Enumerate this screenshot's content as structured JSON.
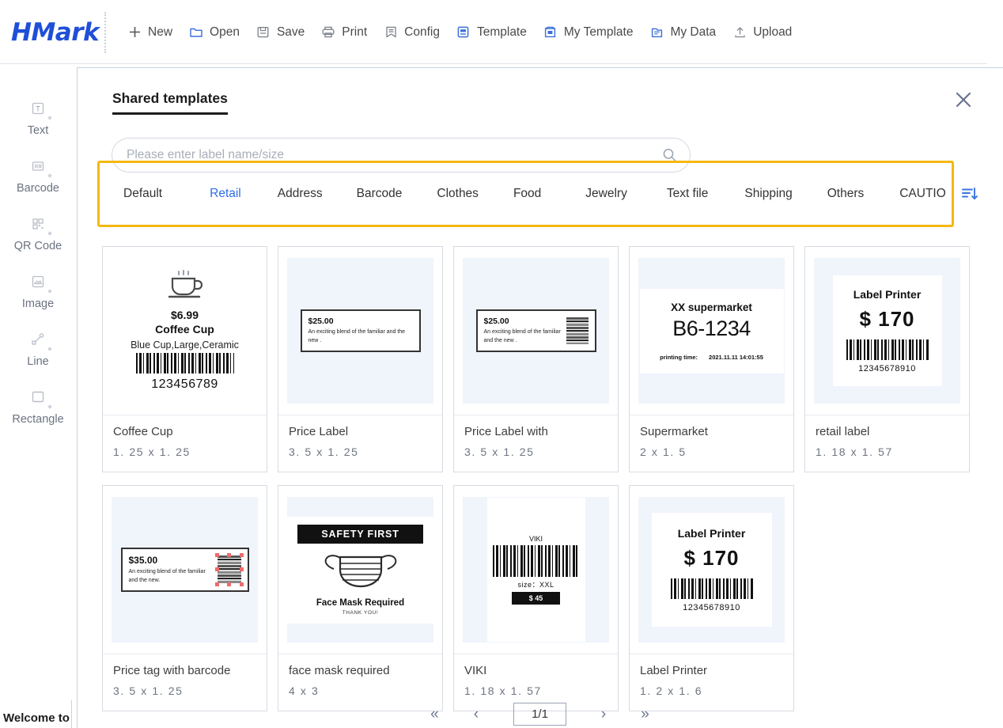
{
  "app": {
    "brand": "HMark",
    "menu": [
      {
        "label": "New",
        "icon": "plus-icon"
      },
      {
        "label": "Open",
        "icon": "folder-icon"
      },
      {
        "label": "Save",
        "icon": "save-disk-icon"
      },
      {
        "label": "Print",
        "icon": "printer-icon"
      },
      {
        "label": "Config",
        "icon": "bookmark-config-icon"
      },
      {
        "label": "Template",
        "icon": "template-icon"
      },
      {
        "label": "My Template",
        "icon": "my-template-icon"
      },
      {
        "label": "My Data",
        "icon": "my-data-icon"
      },
      {
        "label": "Upload",
        "icon": "upload-icon"
      }
    ]
  },
  "toolbar_rail": {
    "tools": [
      {
        "label": "Text",
        "icon": "text-tool-icon"
      },
      {
        "label": "Barcode",
        "icon": "barcode-tool-icon"
      },
      {
        "label": "QR Code",
        "icon": "qrcode-tool-icon"
      },
      {
        "label": "Image",
        "icon": "image-tool-icon"
      },
      {
        "label": "Line",
        "icon": "line-tool-icon"
      },
      {
        "label": "Rectangle",
        "icon": "rectangle-tool-icon"
      }
    ]
  },
  "dialog": {
    "title": "Shared templates",
    "close_icon": "close-icon",
    "search": {
      "placeholder": "Please enter label name/size",
      "value": "",
      "icon": "search-icon"
    },
    "sort_icon": "sort-descending-icon",
    "highlight_color": "#f5b812",
    "active_tab_color": "#2f6fe4",
    "tabs": [
      {
        "label": "Default",
        "active": false
      },
      {
        "label": "Retail",
        "active": true
      },
      {
        "label": "Address",
        "active": false
      },
      {
        "label": "Barcode",
        "active": false
      },
      {
        "label": "Clothes",
        "active": false
      },
      {
        "label": "Food",
        "active": false
      },
      {
        "label": "Jewelry",
        "active": false
      },
      {
        "label": "Text file",
        "active": false
      },
      {
        "label": "Shipping",
        "active": false
      },
      {
        "label": "Others",
        "active": false
      },
      {
        "label": "CAUTIO",
        "active": false
      }
    ],
    "templates": [
      {
        "name": "Coffee Cup",
        "size": "1. 25  x  1. 25",
        "preview": {
          "kind": "coffee",
          "price": "$6.99",
          "title": "Coffee Cup",
          "desc": "Blue Cup,Large,Ceramic",
          "barcode_number": "123456789"
        }
      },
      {
        "name": "Price Label",
        "size": "3. 5  x  1. 25",
        "preview": {
          "kind": "pricelabel",
          "price": "$25.00",
          "desc": "An exciting blend of  the familiar and the new .",
          "barcode": false
        }
      },
      {
        "name": "Price Label with",
        "size": "3. 5  x  1. 25",
        "preview": {
          "kind": "pricelabel",
          "price": "$25.00",
          "desc": "An exciting blend of  the familiar and the new .",
          "barcode": true
        }
      },
      {
        "name": "Supermarket",
        "size": "2  x  1. 5",
        "preview": {
          "kind": "supermarket",
          "header": "XX supermarket",
          "code": "B6-1234",
          "time_label": "printing time:",
          "time_value": "2021.11.11 14:01:55"
        }
      },
      {
        "name": "retail label",
        "size": "1. 18  x  1. 57",
        "preview": {
          "kind": "labelprinter",
          "header": "Label Printer",
          "price": "$ 170",
          "barcode_number": "12345678910"
        }
      },
      {
        "name": "Price tag with barcode",
        "size": "3. 5  x  1. 25",
        "preview": {
          "kind": "pricetag",
          "price": "$35.00",
          "desc": "An exciting blend of the familiar and the new."
        }
      },
      {
        "name": "face mask required",
        "size": "4  x  3",
        "preview": {
          "kind": "facemask",
          "banner": "SAFETY FIRST",
          "title": "Face Mask Required",
          "footer": "THANK YOU!"
        }
      },
      {
        "name": "VIKI",
        "size": "1. 18  x  1. 57",
        "preview": {
          "kind": "viki",
          "title": "VIKI",
          "size_text": "size：XXL",
          "price": "$ 45"
        }
      },
      {
        "name": "Label Printer",
        "size": "1. 2  x  1. 6",
        "preview": {
          "kind": "labelprinter",
          "header": "Label Printer",
          "price": "$ 170",
          "barcode_number": "12345678910"
        }
      }
    ]
  },
  "pagination": {
    "first": "«",
    "prev": "‹",
    "current": "1/1",
    "next": "›",
    "last": "»"
  },
  "status_bar": {
    "text": "Welcome to"
  }
}
